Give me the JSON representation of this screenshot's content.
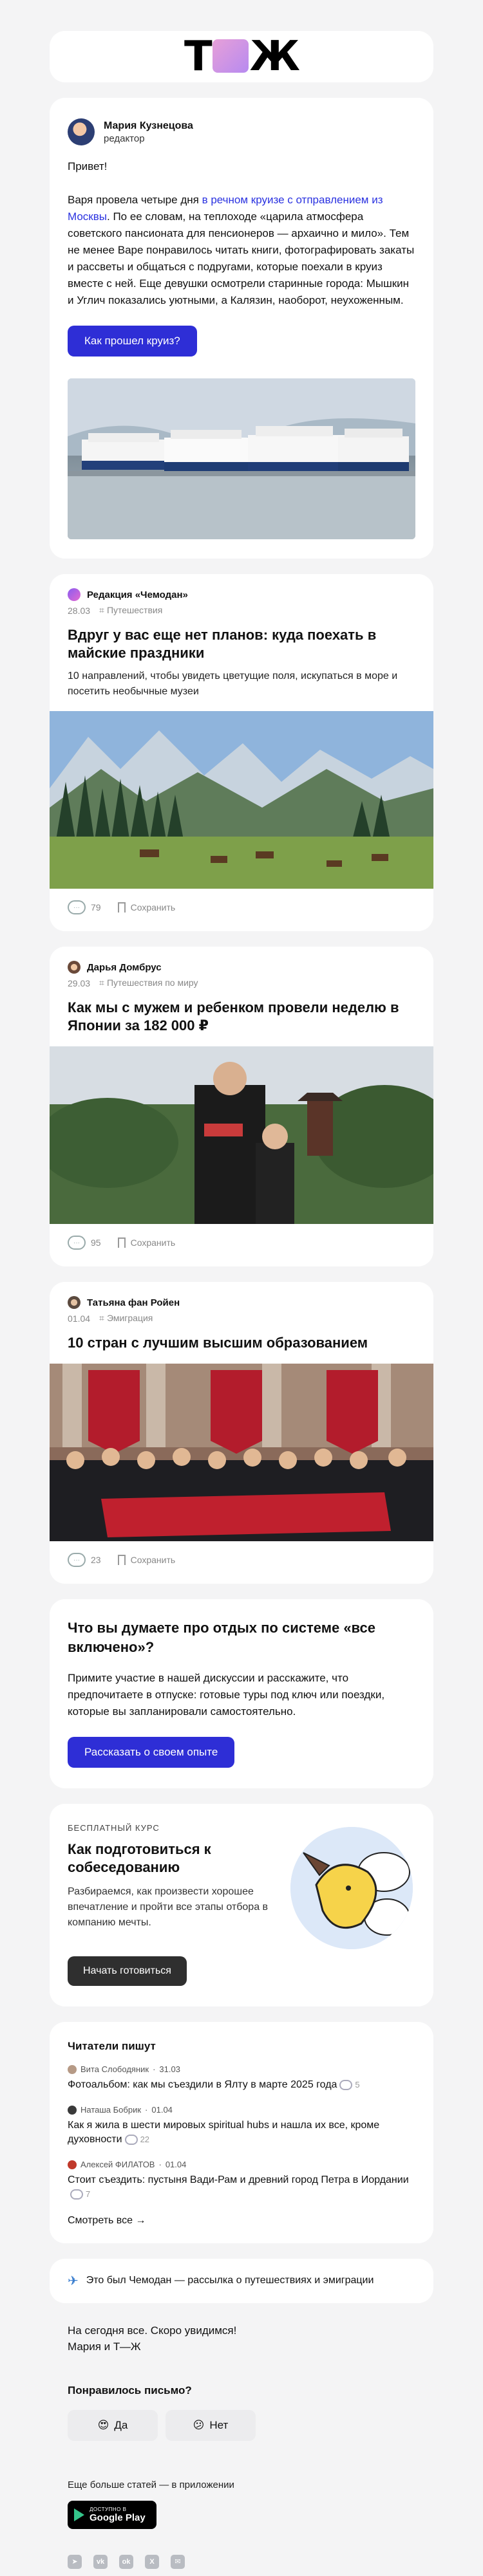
{
  "logo": {
    "text_left": "Т",
    "text_right": "Ж"
  },
  "editor": {
    "name": "Мария Кузнецова",
    "role": "редактор",
    "greeting": "Привет!",
    "para_start": "Варя провела четыре дня ",
    "para_link": "в речном круизе с отправлением из Москвы",
    "para_end": ". По ее словам, на теплоходе «царила атмосфера советского пансионата для пенсионеров — архаично и мило». Тем не менее Варе понравилось читать книги, фотографировать закаты и рассветы и общаться с подругами, которые поехали в круиз вместе с ней. Еще девушки осмотрели старинные города: Мышкин и Углич показались уютными, а Калязин, наоборот, неухоженным.",
    "button": "Как прошел круиз?"
  },
  "articles": [
    {
      "source": "Редакция «Чемодан»",
      "date": "28.03",
      "tag": "Путешествия",
      "title": "Вдруг у вас еще нет планов: куда поехать в майские праздники",
      "lead": "10 направлений, чтобы увидеть цветущие поля, искупаться в море и посетить необычные музеи",
      "comments": "79",
      "save": "Сохранить"
    },
    {
      "source": "Дарья Домбрус",
      "date": "29.03",
      "tag": "Путешествия по миру",
      "title": "Как мы с мужем и ребенком провели неделю в Японии за 182 000 ₽",
      "lead": "",
      "comments": "95",
      "save": "Сохранить"
    },
    {
      "source": "Татьяна фан Ройен",
      "date": "01.04",
      "tag": "Эмиграция",
      "title": "10 стран с лучшим высшим образованием",
      "lead": "",
      "comments": "23",
      "save": "Сохранить"
    }
  ],
  "discussion": {
    "title": "Что вы думаете про отдых по системе «все включено»?",
    "text": "Примите участие в нашей дискуссии и расскажите, что предпочитаете в отпуске: готовые туры под ключ или поездки, которые вы запланировали самостоятельно.",
    "button": "Рассказать о своем опыте"
  },
  "course": {
    "kicker": "БЕСПЛАТНЫЙ КУРС",
    "title": "Как подготовиться к собеседованию",
    "text": "Разбираемся, как произвести хорошее впечатление и пройти все этапы отбора в компанию мечты.",
    "button": "Начать готовиться"
  },
  "readers": {
    "title": "Читатели пишут",
    "items": [
      {
        "author": "Вита Слободяник",
        "date": "31.03",
        "text": "Фотоальбом: как мы съездили в Ялту в марте 2025 года",
        "count": "5"
      },
      {
        "author": "Наташа Бобрик",
        "date": "01.04",
        "text": "Как я жила в шести мировых spiritual hubs и нашла их все, кроме духовности",
        "count": "22"
      },
      {
        "author": "Алексей ФИЛАТОВ",
        "date": "01.04",
        "text": "Стоит съездить: пустыня Вади-Рам и древний город Петра в Иордании",
        "count": "7"
      }
    ],
    "see_all": "Смотреть все"
  },
  "chemodan": {
    "text": "Это был Чемодан — рассылка о путешествиях и эмиграции"
  },
  "signoff": {
    "line1": "На сегодня все. Скоро увидимся!",
    "line2": "Мария и Т—Ж"
  },
  "feedback": {
    "title": "Понравилось письмо?",
    "yes": "Да",
    "no": "Нет"
  },
  "app": {
    "text": "Еще больше статей — в приложении",
    "store_small": "ДОСТУПНО В",
    "store_big": "Google Play"
  },
  "socials": [
    "telegram",
    "vk",
    "ok",
    "x",
    "email"
  ]
}
